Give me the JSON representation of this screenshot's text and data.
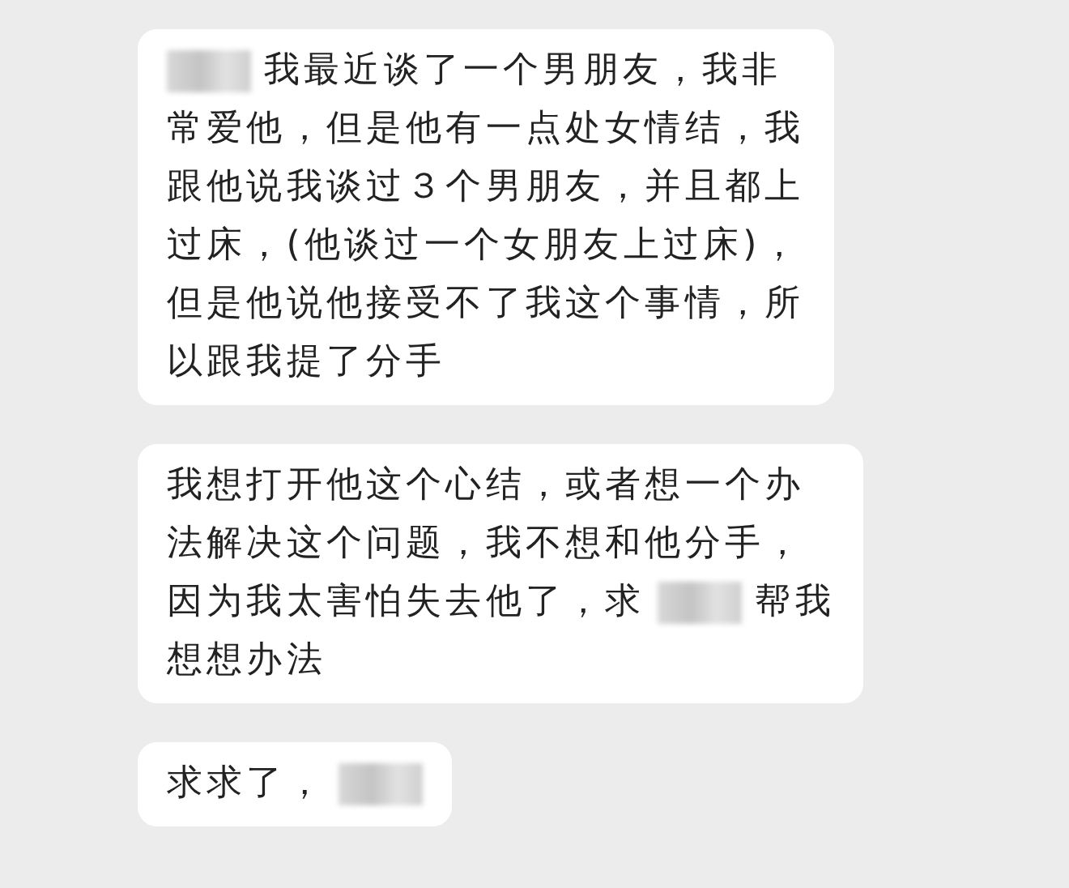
{
  "messages": [
    {
      "lines": [
        [
          {
            "kind": "redacted"
          },
          {
            "kind": "text",
            "text": "我最近谈了一个男朋友，我非"
          }
        ],
        [
          {
            "kind": "text",
            "text": "常爱他，但是他有一点处女情结，我"
          }
        ],
        [
          {
            "kind": "text",
            "text": "跟他说我谈过３个男朋友，并且都上"
          }
        ],
        [
          {
            "kind": "text",
            "text": "过床，(他谈过一个女朋友上过床)，"
          }
        ],
        [
          {
            "kind": "text",
            "text": "但是他说他接受不了我这个事情，所"
          }
        ],
        [
          {
            "kind": "text",
            "text": "以跟我提了分手"
          }
        ]
      ]
    },
    {
      "lines": [
        [
          {
            "kind": "text",
            "text": "我想打开他这个心结，或者想一个办"
          }
        ],
        [
          {
            "kind": "text",
            "text": "法解决这个问题，我不想和他分手，"
          }
        ],
        [
          {
            "kind": "text",
            "text": "因为我太害怕失去他了，求"
          },
          {
            "kind": "redacted"
          },
          {
            "kind": "text",
            "text": "帮我"
          }
        ],
        [
          {
            "kind": "text",
            "text": "想想办法"
          }
        ]
      ]
    },
    {
      "lines": [
        [
          {
            "kind": "text",
            "text": "求求了，"
          },
          {
            "kind": "redacted"
          }
        ]
      ]
    }
  ]
}
